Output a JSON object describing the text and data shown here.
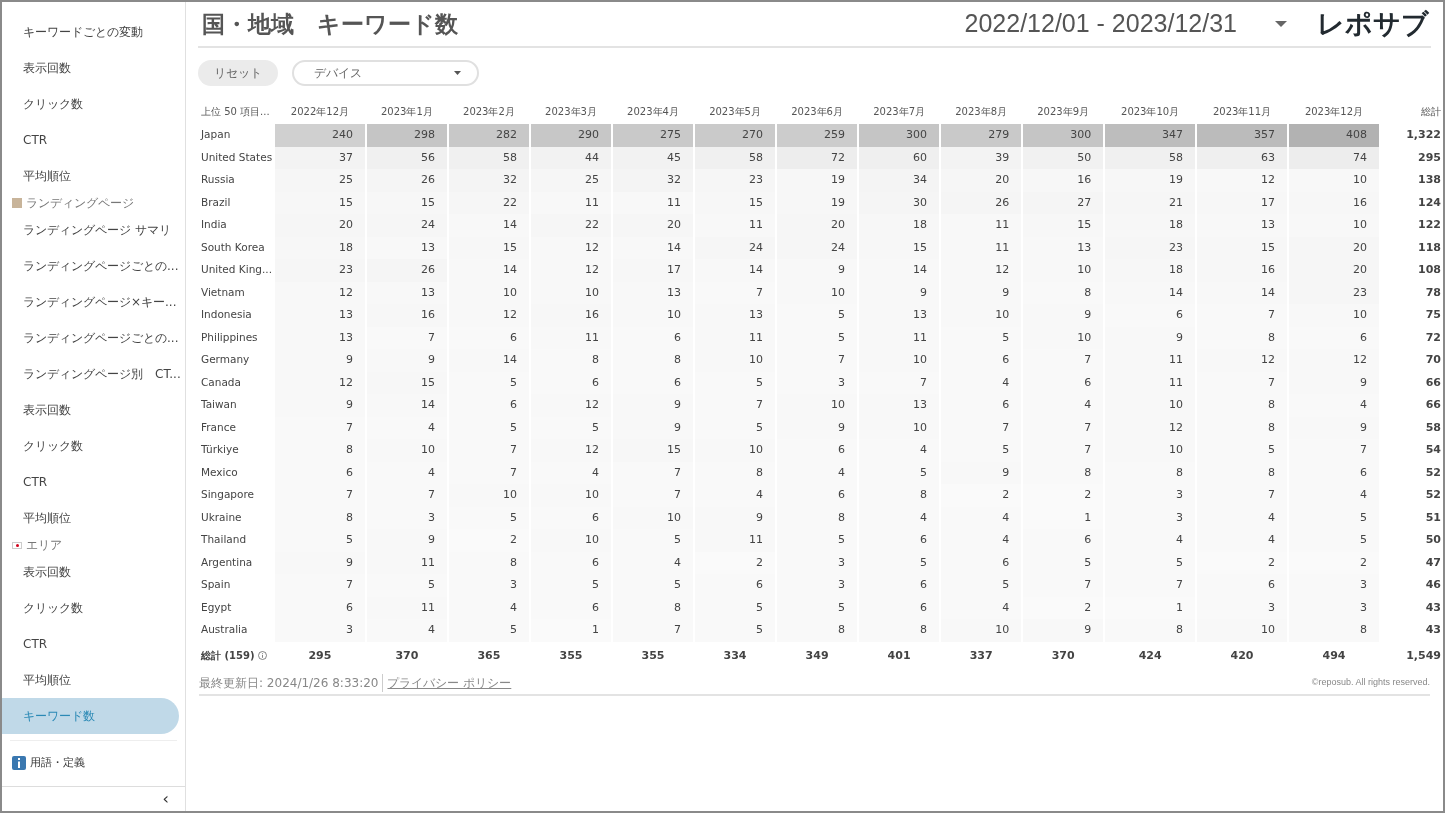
{
  "sidebar": {
    "items": [
      {
        "kind": "item",
        "label": "キーワードごとの変動",
        "selected": false
      },
      {
        "kind": "item",
        "label": "表示回数",
        "selected": false
      },
      {
        "kind": "item",
        "label": "クリック数",
        "selected": false
      },
      {
        "kind": "item",
        "label": "CTR",
        "selected": false
      },
      {
        "kind": "item",
        "label": "平均順位",
        "selected": false
      },
      {
        "kind": "section",
        "label": "ランディングページ"
      },
      {
        "kind": "item",
        "label": "ランディングページ サマリ",
        "selected": false
      },
      {
        "kind": "item",
        "label": "ランディングページごとの...",
        "selected": false
      },
      {
        "kind": "item",
        "label": "ランディングページ×キー...",
        "selected": false
      },
      {
        "kind": "item",
        "label": "ランディングページごとの...",
        "selected": false
      },
      {
        "kind": "item",
        "label": "ランディングページ別　CT...",
        "selected": false
      },
      {
        "kind": "item",
        "label": "表示回数",
        "selected": false
      },
      {
        "kind": "item",
        "label": "クリック数",
        "selected": false
      },
      {
        "kind": "item",
        "label": "CTR",
        "selected": false
      },
      {
        "kind": "item",
        "label": "平均順位",
        "selected": false
      },
      {
        "kind": "section",
        "label": "エリア"
      },
      {
        "kind": "item",
        "label": "表示回数",
        "selected": false
      },
      {
        "kind": "item",
        "label": "クリック数",
        "selected": false
      },
      {
        "kind": "item",
        "label": "CTR",
        "selected": false
      },
      {
        "kind": "item",
        "label": "平均順位",
        "selected": false
      },
      {
        "kind": "item",
        "label": "キーワード数",
        "selected": true
      }
    ],
    "glossary": "用語・定義",
    "collapse": "‹"
  },
  "header": {
    "title": "国・地域　キーワード数",
    "date_range": "2022/12/01 - 2023/12/31",
    "logo": "レポサブ"
  },
  "controls": {
    "reset": "リセット",
    "device_dropdown": "デバイス"
  },
  "table": {
    "columns": [
      "上位 50 項目...",
      "2022年12月",
      "2023年1月",
      "2023年2月",
      "2023年3月",
      "2023年4月",
      "2023年5月",
      "2023年6月",
      "2023年7月",
      "2023年8月",
      "2023年9月",
      "2023年10月",
      "2023年11月",
      "2023年12月",
      "総計"
    ],
    "rows": [
      {
        "country": "Japan",
        "values": [
          "240",
          "298",
          "282",
          "290",
          "275",
          "270",
          "259",
          "300",
          "279",
          "300",
          "347",
          "357",
          "408"
        ],
        "total": "1,322"
      },
      {
        "country": "United States",
        "values": [
          "37",
          "56",
          "58",
          "44",
          "45",
          "58",
          "72",
          "60",
          "39",
          "50",
          "58",
          "63",
          "74"
        ],
        "total": "295"
      },
      {
        "country": "Russia",
        "values": [
          "25",
          "26",
          "32",
          "25",
          "32",
          "23",
          "19",
          "34",
          "20",
          "16",
          "19",
          "12",
          "10"
        ],
        "total": "138"
      },
      {
        "country": "Brazil",
        "values": [
          "15",
          "15",
          "22",
          "11",
          "11",
          "15",
          "19",
          "30",
          "26",
          "27",
          "21",
          "17",
          "16"
        ],
        "total": "124"
      },
      {
        "country": "India",
        "values": [
          "20",
          "24",
          "14",
          "22",
          "20",
          "11",
          "20",
          "18",
          "11",
          "15",
          "18",
          "13",
          "10"
        ],
        "total": "122"
      },
      {
        "country": "South Korea",
        "values": [
          "18",
          "13",
          "15",
          "12",
          "14",
          "24",
          "24",
          "15",
          "11",
          "13",
          "23",
          "15",
          "20"
        ],
        "total": "118"
      },
      {
        "country": "United King...",
        "values": [
          "23",
          "26",
          "14",
          "12",
          "17",
          "14",
          "9",
          "14",
          "12",
          "10",
          "18",
          "16",
          "20"
        ],
        "total": "108"
      },
      {
        "country": "Vietnam",
        "values": [
          "12",
          "13",
          "10",
          "10",
          "13",
          "7",
          "10",
          "9",
          "9",
          "8",
          "14",
          "14",
          "23"
        ],
        "total": "78"
      },
      {
        "country": "Indonesia",
        "values": [
          "13",
          "16",
          "12",
          "16",
          "10",
          "13",
          "5",
          "13",
          "10",
          "9",
          "6",
          "7",
          "10"
        ],
        "total": "75"
      },
      {
        "country": "Philippines",
        "values": [
          "13",
          "7",
          "6",
          "11",
          "6",
          "11",
          "5",
          "11",
          "5",
          "10",
          "9",
          "8",
          "6"
        ],
        "total": "72"
      },
      {
        "country": "Germany",
        "values": [
          "9",
          "9",
          "14",
          "8",
          "8",
          "10",
          "7",
          "10",
          "6",
          "7",
          "11",
          "12",
          "12"
        ],
        "total": "70"
      },
      {
        "country": "Canada",
        "values": [
          "12",
          "15",
          "5",
          "6",
          "6",
          "5",
          "3",
          "7",
          "4",
          "6",
          "11",
          "7",
          "9"
        ],
        "total": "66"
      },
      {
        "country": "Taiwan",
        "values": [
          "9",
          "14",
          "6",
          "12",
          "9",
          "7",
          "10",
          "13",
          "6",
          "4",
          "10",
          "8",
          "4"
        ],
        "total": "66"
      },
      {
        "country": "France",
        "values": [
          "7",
          "4",
          "5",
          "5",
          "9",
          "5",
          "9",
          "10",
          "7",
          "7",
          "12",
          "8",
          "9"
        ],
        "total": "58"
      },
      {
        "country": "Türkiye",
        "values": [
          "8",
          "10",
          "7",
          "12",
          "15",
          "10",
          "6",
          "4",
          "5",
          "7",
          "10",
          "5",
          "7"
        ],
        "total": "54"
      },
      {
        "country": "Mexico",
        "values": [
          "6",
          "4",
          "7",
          "4",
          "7",
          "8",
          "4",
          "5",
          "9",
          "8",
          "8",
          "8",
          "6"
        ],
        "total": "52"
      },
      {
        "country": "Singapore",
        "values": [
          "7",
          "7",
          "10",
          "10",
          "7",
          "4",
          "6",
          "8",
          "2",
          "2",
          "3",
          "7",
          "4"
        ],
        "total": "52"
      },
      {
        "country": "Ukraine",
        "values": [
          "8",
          "3",
          "5",
          "6",
          "10",
          "9",
          "8",
          "4",
          "4",
          "1",
          "3",
          "4",
          "5"
        ],
        "total": "51"
      },
      {
        "country": "Thailand",
        "values": [
          "5",
          "9",
          "2",
          "10",
          "5",
          "11",
          "5",
          "6",
          "4",
          "6",
          "4",
          "4",
          "5"
        ],
        "total": "50"
      },
      {
        "country": "Argentina",
        "values": [
          "9",
          "11",
          "8",
          "6",
          "4",
          "2",
          "3",
          "5",
          "6",
          "5",
          "5",
          "2",
          "2"
        ],
        "total": "47"
      },
      {
        "country": "Spain",
        "values": [
          "7",
          "5",
          "3",
          "5",
          "5",
          "6",
          "3",
          "6",
          "5",
          "7",
          "7",
          "6",
          "3"
        ],
        "total": "46"
      },
      {
        "country": "Egypt",
        "values": [
          "6",
          "11",
          "4",
          "6",
          "8",
          "5",
          "5",
          "6",
          "4",
          "2",
          "1",
          "3",
          "3"
        ],
        "total": "43"
      },
      {
        "country": "Australia",
        "values": [
          "3",
          "4",
          "5",
          "1",
          "7",
          "5",
          "8",
          "8",
          "10",
          "9",
          "8",
          "10",
          "8"
        ],
        "total": "43"
      }
    ],
    "totals": {
      "label": "総計 (159)",
      "values": [
        "295",
        "370",
        "365",
        "355",
        "355",
        "334",
        "349",
        "401",
        "337",
        "370",
        "424",
        "420",
        "494"
      ],
      "total": "1,549"
    }
  },
  "footer": {
    "updated": "最終更新日: 2024/1/26 8:33:20",
    "privacy_link": "プライバシー ポリシー",
    "copyright": "©reposub. All rights reserved."
  }
}
